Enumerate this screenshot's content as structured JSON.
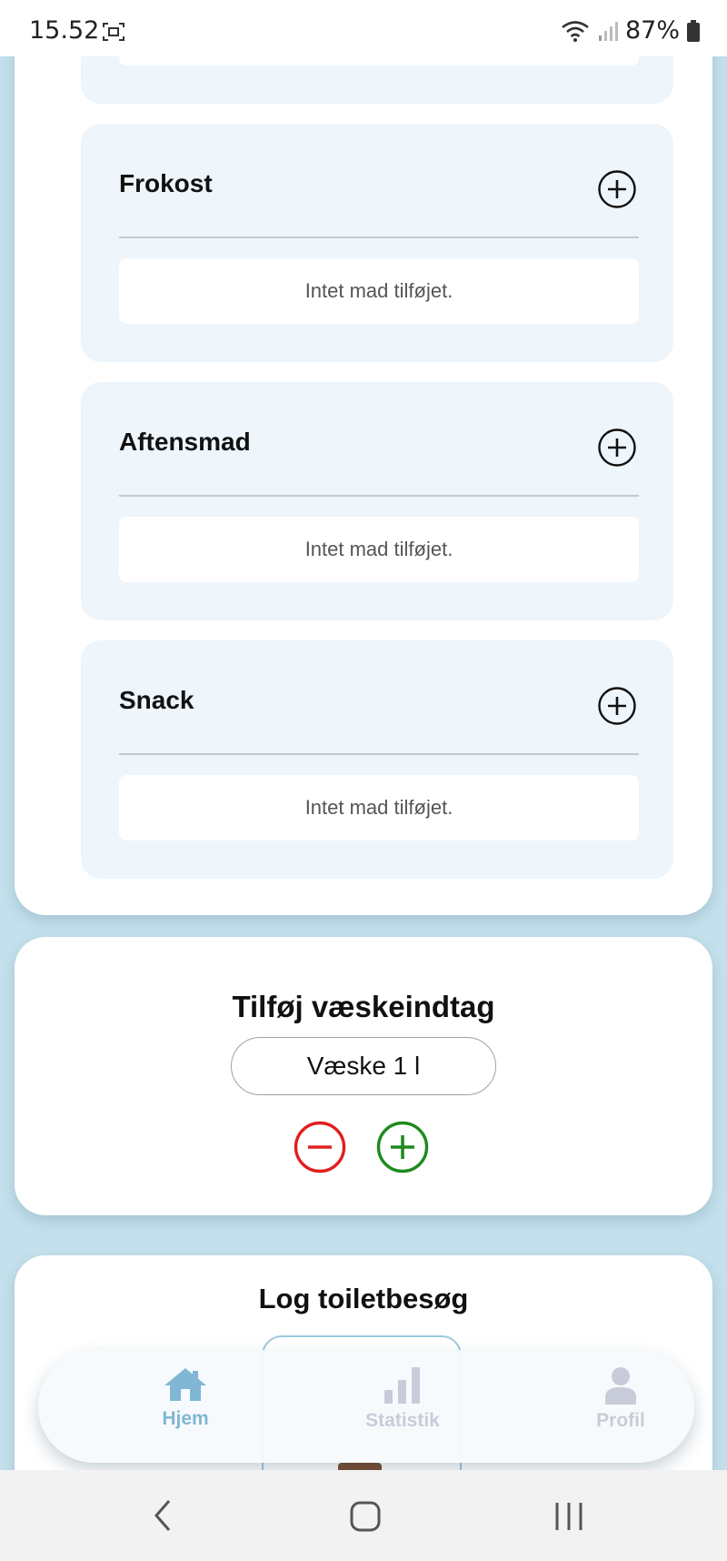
{
  "status_bar": {
    "time": "15.52",
    "battery": "87%"
  },
  "meals": [
    {
      "title": "Frokost",
      "empty_text": "Intet mad tilføjet."
    },
    {
      "title": "Aftensmad",
      "empty_text": "Intet mad tilføjet."
    },
    {
      "title": "Snack",
      "empty_text": "Intet mad tilføjet."
    }
  ],
  "liquid": {
    "title": "Tilføj væskeindtag",
    "value_label": "Væske 1 l"
  },
  "toilet": {
    "title": "Log toiletbesøg"
  },
  "bottom_nav": {
    "items": [
      {
        "label": "Hjem",
        "icon": "home-icon",
        "active": true
      },
      {
        "label": "Statistik",
        "icon": "bar-chart-icon",
        "active": false
      },
      {
        "label": "Profil",
        "icon": "person-icon",
        "active": false
      }
    ]
  },
  "colors": {
    "background": "#c3e0ec",
    "nav_active": "#7fb7d4",
    "nav_inactive": "#c8ccd8",
    "minus": "#e02020",
    "plus": "#1f8a1f"
  }
}
